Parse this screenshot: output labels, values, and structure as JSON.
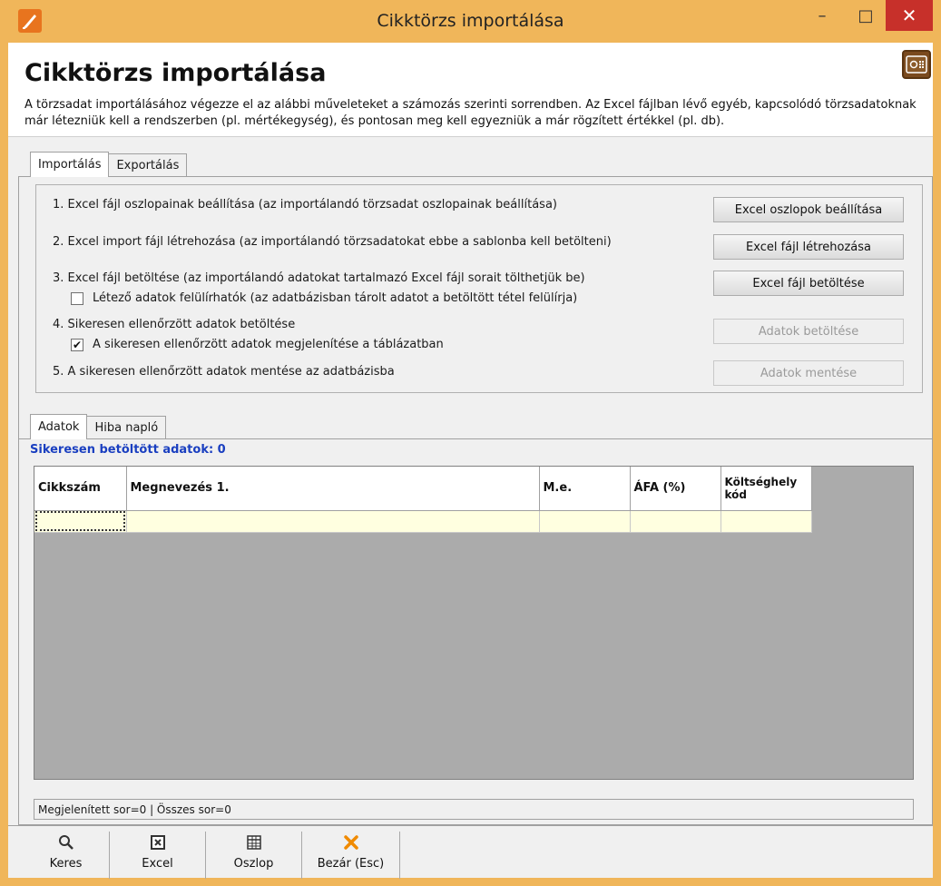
{
  "window": {
    "title": "Cikktörzs importálása",
    "minimize": "–",
    "maximize": "□",
    "close": "✕"
  },
  "header": {
    "title": "Cikktörzs importálása",
    "description": "A törzsadat importálásához végezze el az alábbi műveleteket a számozás szerinti sorrendben. Az Excel fájlban lévő egyéb, kapcsolódó törzsadatoknak már létezniük kell a rendszerben (pl. mértékegység), és pontosan meg kell egyezniük a már rögzített értékkel (pl. db)."
  },
  "top_tabs": [
    {
      "label": "Importálás",
      "active": true
    },
    {
      "label": "Exportálás",
      "active": false
    }
  ],
  "steps": {
    "step1": "1. Excel fájl oszlopainak beállítása (az importálandó törzsadat oszlopainak beállítása)",
    "step2": "2. Excel import fájl létrehozása (az importálandó törzsadatokat ebbe a sablonba kell betölteni)",
    "step3": "3. Excel fájl betöltése (az importálandó adatokat tartalmazó Excel fájl sorait tölthetjük be)",
    "overwrite_label": "Létező adatok felülírhatók (az adatbázisban tárolt adatot a betöltött tétel felülírja)",
    "overwrite_checked": false,
    "step4": "4. Sikeresen ellenőrzött adatok betöltése",
    "show_in_table_label": "A sikeresen ellenőrzött adatok megjelenítése a táblázatban",
    "show_in_table_checked": true,
    "step5": "5. A sikeresen ellenőrzött adatok mentése az adatbázisba"
  },
  "buttons": {
    "excel_columns": "Excel oszlopok beállítása",
    "create_file": "Excel fájl létrehozása",
    "load_file": "Excel fájl betöltése",
    "load_data": "Adatok betöltése",
    "save_data": "Adatok mentése"
  },
  "bottom_tabs": [
    {
      "label": "Adatok",
      "active": true
    },
    {
      "label": "Hiba napló",
      "active": false
    }
  ],
  "loaded_label": "Sikeresen betöltött adatok: 0",
  "grid": {
    "columns": [
      "Cikkszám",
      "Megnevezés 1.",
      "M.e.",
      "ÁFA (%)",
      "Költséghely kód"
    ],
    "status": "Megjelenített sor=0 | Összes sor=0"
  },
  "toolbar": [
    {
      "label": "Keres",
      "icon": "magnifier-icon"
    },
    {
      "label": "Excel",
      "icon": "excel-icon"
    },
    {
      "label": "Oszlop",
      "icon": "columns-icon"
    },
    {
      "label": "Bezár (Esc)",
      "icon": "close-x-icon"
    }
  ],
  "colors": {
    "frame": "#f0b65a",
    "close_button": "#c7302a",
    "loaded_label": "#1a3fc0",
    "row_highlight": "#ffffe0",
    "bezar_icon": "#f08a00"
  }
}
